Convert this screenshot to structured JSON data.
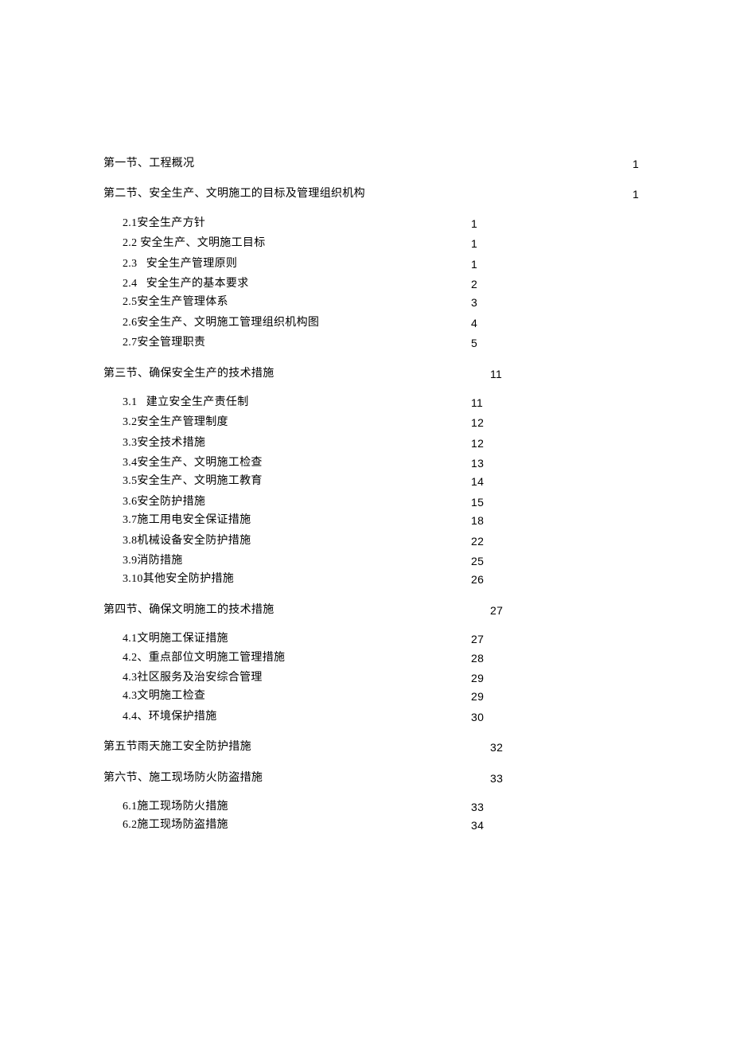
{
  "sections": [
    {
      "label": "第一节、工程概况",
      "page": "1",
      "indent": 0,
      "far_right": true
    },
    {
      "label": "第二节、安全生产、文明施工的目标及管理组织机构",
      "page": "1",
      "indent": 0,
      "far_right": true,
      "gap_before": true
    },
    {
      "label": "2.1安全生产方针",
      "page": "1",
      "indent": 1,
      "gap_before": true
    },
    {
      "label": "2.2 安全生产、文明施工目标",
      "page": "1",
      "indent": 1
    },
    {
      "label": "2.3   安全生产管理原则",
      "page": "1",
      "indent": 1
    },
    {
      "label": "2.4   安全生产的基本要求",
      "page": "2",
      "indent": 1
    },
    {
      "label": "2.5安全生产管理体系",
      "page": "3",
      "indent": 1,
      "tight_above": true
    },
    {
      "label": "2.6安全生产、文明施工管理组织机构图",
      "page": "4",
      "indent": 1
    },
    {
      "label": "2.7安全管理职责",
      "page": "5",
      "indent": 1
    },
    {
      "label": "第三节、确保安全生产的技术措施",
      "page": "11",
      "indent": 0,
      "gap_before": true
    },
    {
      "label": "3.1   建立安全生产责任制",
      "page": "11",
      "indent": 1,
      "gap_before": true
    },
    {
      "label": "3.2安全生产管理制度",
      "page": "12",
      "indent": 1
    },
    {
      "label": "3.3安全技术措施",
      "page": "12",
      "indent": 1
    },
    {
      "label": "3.4安全生产、文明施工检查",
      "page": "13",
      "indent": 1
    },
    {
      "label": "3.5安全生产、文明施工教育",
      "page": "14",
      "indent": 1,
      "tight_above": true
    },
    {
      "label": "3.6安全防护措施",
      "page": "15",
      "indent": 1
    },
    {
      "label": "3.7施工用电安全保证措施",
      "page": "18",
      "indent": 1,
      "tight_above": true
    },
    {
      "label": "3.8机械设备安全防护措施",
      "page": "22",
      "indent": 1
    },
    {
      "label": "3.9消防措施",
      "page": "25",
      "indent": 1
    },
    {
      "label": "3.10其他安全防护措施",
      "page": "26",
      "indent": 1,
      "tight_above": true
    },
    {
      "label": "第四节、确保文明施工的技术措施",
      "page": "27",
      "indent": 0,
      "gap_before": true
    },
    {
      "label": "4.1文明施工保证措施",
      "page": "27",
      "indent": 1,
      "gap_before": true
    },
    {
      "label": "4.2、重点部位文明施工管理措施",
      "page": "28",
      "indent": 1,
      "tight_above": true
    },
    {
      "label": "4.3社区服务及治安综合管理",
      "page": "29",
      "indent": 1
    },
    {
      "label": "4.3文明施工检查",
      "page": "29",
      "indent": 1,
      "tight_above": true
    },
    {
      "label": "4.4、环境保护措施",
      "page": "30",
      "indent": 1
    },
    {
      "label": "第五节雨天施工安全防护措施",
      "page": "32",
      "indent": 0,
      "gap_before": true
    },
    {
      "label": "第六节、施工现场防火防盗措施",
      "page": "33",
      "indent": 0,
      "gap_before": true
    },
    {
      "label": "6.1施工现场防火措施",
      "page": "33",
      "indent": 1,
      "gap_before": true
    },
    {
      "label": "6.2施工现场防盗措施",
      "page": "34",
      "indent": 1,
      "tight_above": true
    }
  ],
  "layout": {
    "page_col_near": 486,
    "page_col_far": 665
  }
}
